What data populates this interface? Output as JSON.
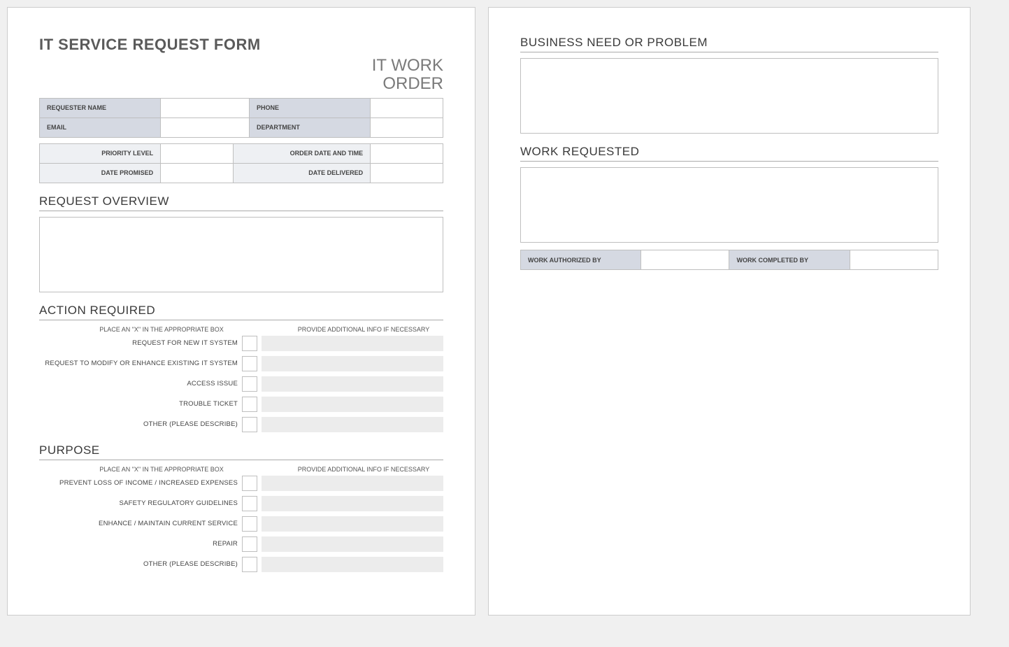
{
  "title": "IT SERVICE REQUEST FORM",
  "subtitle_line1": "IT WORK",
  "subtitle_line2": "ORDER",
  "requester": {
    "name_label": "REQUESTER NAME",
    "name_value": "",
    "phone_label": "PHONE",
    "phone_value": "",
    "email_label": "EMAIL",
    "email_value": "",
    "department_label": "DEPARTMENT",
    "department_value": ""
  },
  "order": {
    "priority_label": "PRIORITY LEVEL",
    "priority_value": "",
    "order_date_label": "ORDER DATE AND TIME",
    "order_date_value": "",
    "date_promised_label": "DATE PROMISED",
    "date_promised_value": "",
    "date_delivered_label": "DATE DELIVERED",
    "date_delivered_value": ""
  },
  "sections": {
    "request_overview": "REQUEST OVERVIEW",
    "action_required": "ACTION REQUIRED",
    "purpose": "PURPOSE",
    "business_need": "BUSINESS NEED OR PROBLEM",
    "work_requested": "WORK REQUESTED"
  },
  "action_required": {
    "col_left": "PLACE AN \"X\" IN THE APPROPRIATE BOX",
    "col_right": "PROVIDE ADDITIONAL INFO IF NECESSARY",
    "rows": [
      "REQUEST FOR NEW IT SYSTEM",
      "REQUEST TO MODIFY OR ENHANCE EXISTING IT SYSTEM",
      "ACCESS ISSUE",
      "TROUBLE TICKET",
      "OTHER (PLEASE DESCRIBE)"
    ]
  },
  "purpose": {
    "col_left": "PLACE AN \"X\" IN THE APPROPRIATE BOX",
    "col_right": "PROVIDE ADDITIONAL INFO IF NECESSARY",
    "rows": [
      "PREVENT LOSS OF INCOME / INCREASED EXPENSES",
      "SAFETY REGULATORY GUIDELINES",
      "ENHANCE / MAINTAIN CURRENT SERVICE",
      "REPAIR",
      "OTHER (PLEASE DESCRIBE)"
    ]
  },
  "auth": {
    "authorized_label": "WORK AUTHORIZED BY",
    "authorized_value": "",
    "completed_label": "WORK COMPLETED BY",
    "completed_value": ""
  }
}
